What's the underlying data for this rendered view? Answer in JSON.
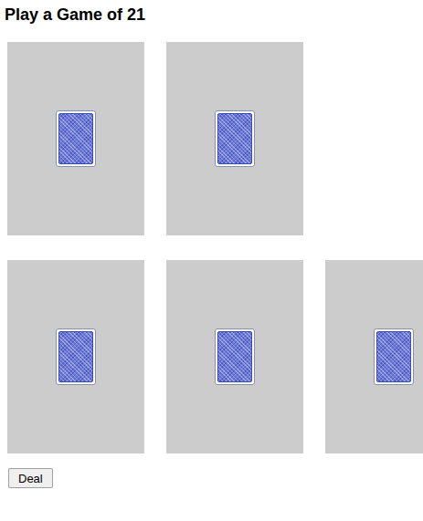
{
  "title": "Play a Game of 21",
  "dealer": {
    "cards": [
      {
        "faceUp": false
      },
      {
        "faceUp": false
      }
    ]
  },
  "player": {
    "cards": [
      {
        "faceUp": false
      },
      {
        "faceUp": false
      },
      {
        "faceUp": false
      }
    ]
  },
  "buttons": [
    "Deal"
  ]
}
